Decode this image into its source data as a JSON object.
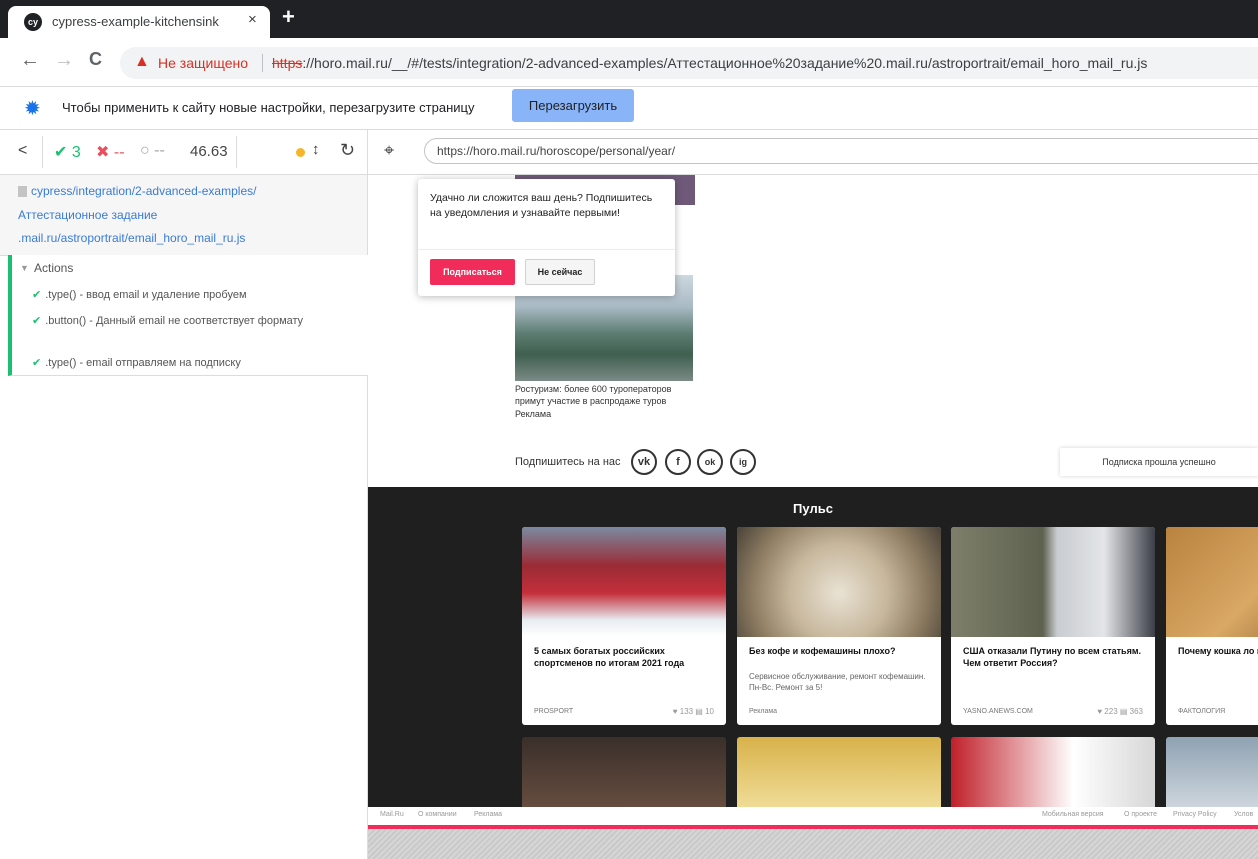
{
  "browser": {
    "tab_title": "cypress-example-kitchensink",
    "tab_favicon": "cy",
    "tab_close": "×",
    "new_tab": "+",
    "nav_back": "←",
    "nav_forward": "→",
    "nav_reload": "C",
    "warning_icon": "▲",
    "not_secure": "Не защищено",
    "url_scheme": "https",
    "url_rest": "://horo.mail.ru/__/#/tests/integration/2-advanced-examples/Аттестационное%20задание%20.mail.ru/astroportrait/email_horo_mail_ru.js"
  },
  "infobar": {
    "text": "Чтобы применить к сайту новые настройки, перезагрузите страницу",
    "button": "Перезагрузить"
  },
  "reporter": {
    "back": "<",
    "passed_icon": "✔",
    "passed": "3",
    "failed_icon": "✖",
    "failed": "--",
    "pending_icon": "○",
    "pending": "--",
    "duration": "46.63",
    "scroll_icon": "↕",
    "rerun_icon": "↻",
    "spec_path_1": "cypress/integration/2-advanced-examples/",
    "spec_path_2": "Аттестационное задание",
    "spec_path_3": ".mail.ru/astroportrait/email_horo_mail_ru.js",
    "actions_caret": "▼",
    "actions_label": "Actions",
    "tests": [
      {
        "check": "✔",
        "title": ".type() - ввод email и удаление пробуем"
      },
      {
        "check": "✔",
        "title": ".button() - Данный email не соответствует форматy"
      },
      {
        "check": "✔",
        "title": ".type() - email отправляем на подписку"
      }
    ]
  },
  "aut": {
    "target_icon": "⌖",
    "url": "https://horo.mail.ru/horoscope/personal/year/",
    "article_text": "Ростуризм: более 600 туроператоров примут участие в распродаже туров",
    "article_tag": "Реклама",
    "follow_label": "Подпишитесь на нас",
    "social": [
      "vk",
      "f",
      "ok",
      "ig"
    ],
    "sub_success": "Подписка прошла успешно",
    "pulse_title": "Пульс",
    "cards": [
      {
        "title": "5 самых богатых российских спортсменов по итогам 2021 года",
        "desc": "",
        "source": "PROSPORT",
        "stats": "♥ 133   ▤ 10"
      },
      {
        "title": "Без кофе и кофемашины плохо?",
        "desc": "Сервисное обслуживание, ремонт кофемашин. Пн-Вс. Ремонт за 5!",
        "source": "Реклама",
        "stats": ""
      },
      {
        "title": "США отказали Путину по всем статьям. Чем ответит Россия?",
        "desc": "",
        "source": "YASNO.ANEWS.COM",
        "stats": "♥ 223   ▤ 363"
      },
      {
        "title": "Почему кошка ло на самом деле?",
        "desc": "",
        "source": "ФАКТОЛОГИЯ",
        "stats": ""
      }
    ],
    "footer_left": [
      "Mail.Ru",
      "О компании",
      "Реклама"
    ],
    "footer_right": [
      "Мобильная версия",
      "О проекте",
      "Privacy Policy",
      "Услов"
    ]
  },
  "popup": {
    "text": "Удачно ли сложится ваш день? Подпишитесь на уведомления и узнавайте первыми!",
    "subscribe": "Подписаться",
    "not_now": "Не сейчас"
  },
  "colors": {
    "pass": "#1bbf72",
    "fail": "#e94f5f",
    "brand_red": "#f22c5a",
    "link_blue": "#3a7bd5"
  }
}
